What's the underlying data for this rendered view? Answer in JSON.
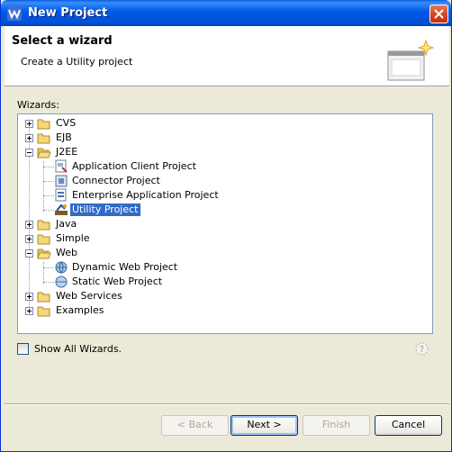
{
  "window": {
    "title": "New Project"
  },
  "banner": {
    "title": "Select a wizard",
    "description": "Create a Utility project"
  },
  "wizards_label": "Wizards:",
  "tree": [
    {
      "label": "CVS"
    },
    {
      "label": "EJB"
    },
    {
      "label": "J2EE"
    },
    {
      "label": "Application Client Project"
    },
    {
      "label": "Connector Project"
    },
    {
      "label": "Enterprise Application Project"
    },
    {
      "label": "Utility Project"
    },
    {
      "label": "Java"
    },
    {
      "label": "Simple"
    },
    {
      "label": "Web"
    },
    {
      "label": "Dynamic Web Project"
    },
    {
      "label": "Static Web Project"
    },
    {
      "label": "Web Services"
    },
    {
      "label": "Examples"
    }
  ],
  "show_all": {
    "label": "Show All Wizards.",
    "checked": false
  },
  "buttons": {
    "back": "< Back",
    "next": "Next >",
    "finish": "Finish",
    "cancel": "Cancel"
  },
  "colors": {
    "titlebar": "#0058e6",
    "selection": "#316ac5",
    "dialog_bg": "#ece9d8"
  }
}
